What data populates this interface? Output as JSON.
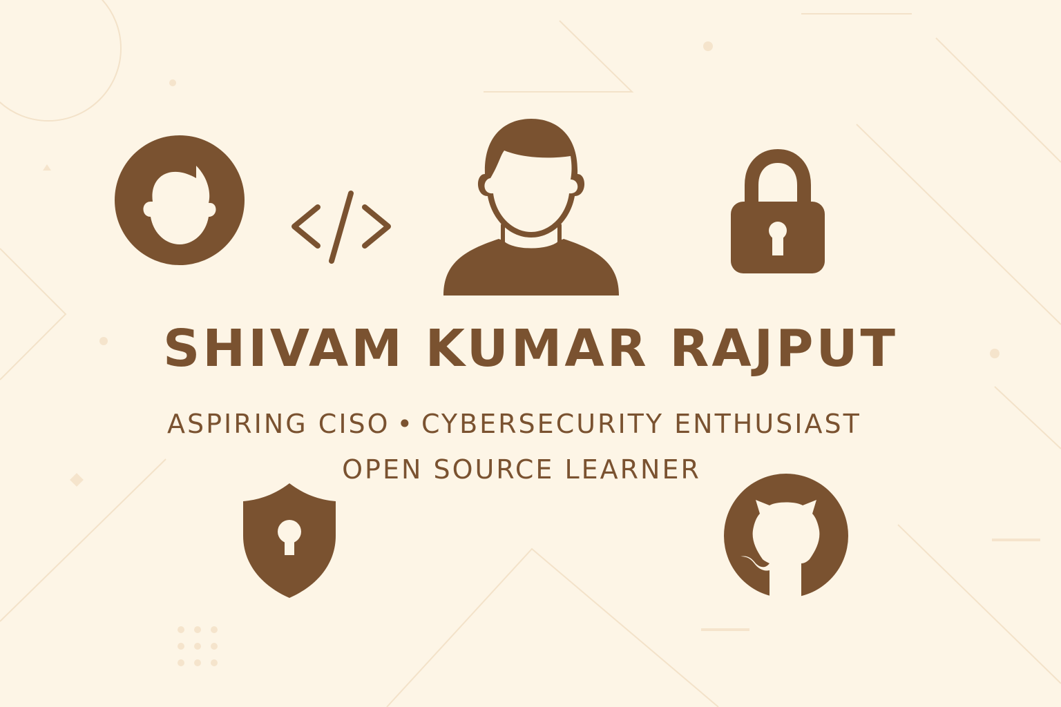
{
  "colors": {
    "background": "#fdf5e6",
    "icon": "#7a5230",
    "text": "#7a5230",
    "decoration": "#f3e2c9"
  },
  "name": "SHIVAM KUMAR RAJPUT",
  "tagline": {
    "first_role": "ASPIRING CISO",
    "separator": "•",
    "second_role": "CYBERSECURITY ENTHUSIAST",
    "third_role": "OPEN SOURCE LEARNER"
  },
  "icons": [
    "avatar-circle-icon",
    "code-icon",
    "person-icon",
    "padlock-icon",
    "shield-keyhole-icon",
    "github-icon"
  ]
}
